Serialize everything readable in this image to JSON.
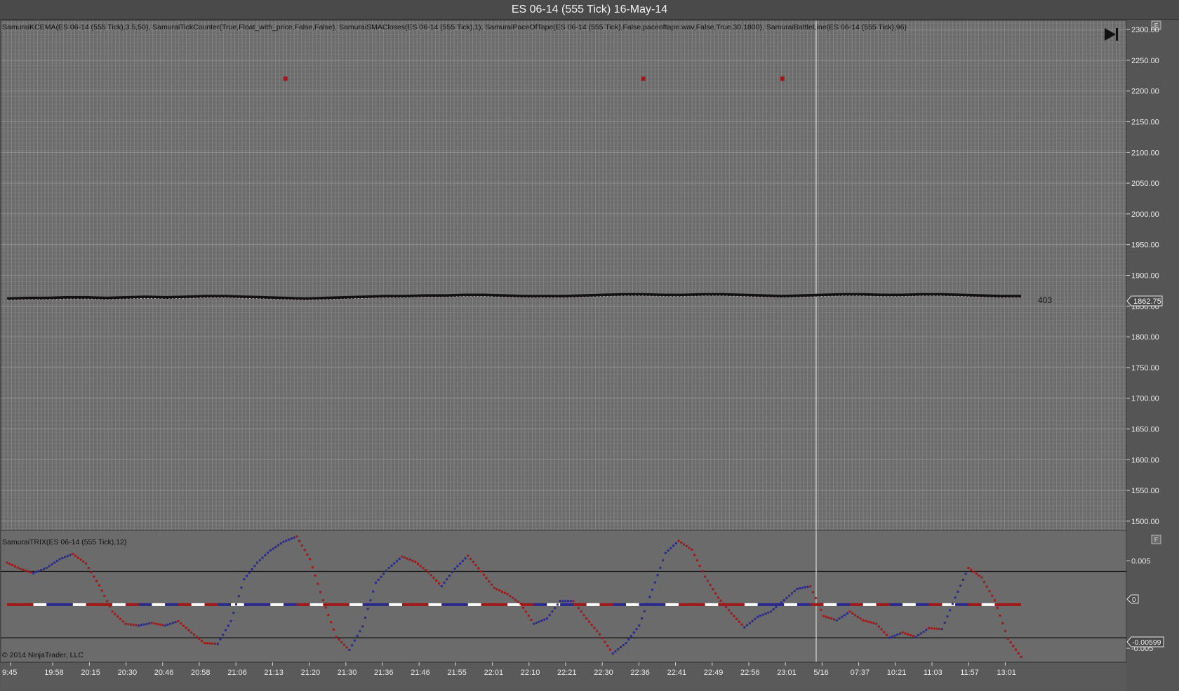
{
  "window": {
    "title": "ES 06-14 (555 Tick)  16-May-14"
  },
  "price_panel": {
    "indicators_label": "SamuraiKCEMA(ES 06-14 (555 Tick),3.5,50), SamuraiTickCounter(True,Float_with_price,False,False), SamuraiSMACloses(ES 06-14 (555 Tick),1), SamuraiPaceOfTape(ES 06-14 (555 Tick),False,paceoftape.wav,False,True,30,1800), SamuraiBattleLine(ES 06-14 (555 Tick),96)",
    "last_price_label": "1862.75",
    "tick_counter": "403",
    "panel_button": "F"
  },
  "trix_panel": {
    "label": "SamuraiTRIX(ES 06-14 (555 Tick),12)",
    "value_label": "-0.00599",
    "zero_label": "0",
    "panel_button": "F"
  },
  "copyright": "© 2014 NinjaTrader, LLC",
  "colors": {
    "background": "#6b6b6b",
    "gridline": "#8a8a8a",
    "price_line": "#111111",
    "price_highlight": "#e8c8c0",
    "trix_up": "#2a2a8c",
    "trix_down": "#a01818",
    "pace_marker": "#a01818",
    "zero_line": "#ffffff"
  },
  "chart_data": [
    {
      "type": "line",
      "title": "",
      "x_tick_labels": [
        "9:45",
        "19:58",
        "20:15",
        "20:30",
        "20:46",
        "20:58",
        "21:06",
        "21:13",
        "21:20",
        "21:30",
        "21:36",
        "21:46",
        "21:55",
        "22:01",
        "22:10",
        "22:21",
        "22:30",
        "22:36",
        "22:41",
        "22:49",
        "22:56",
        "23:01",
        "5/16",
        "07:37",
        "10:21",
        "11:03",
        "11:57",
        "13:01"
      ],
      "y_tick_labels": [
        "2300.00",
        "2250.00",
        "2200.00",
        "2150.00",
        "2100.00",
        "2050.00",
        "2000.00",
        "1950.00",
        "1900.00",
        "1850.00",
        "1800.00",
        "1750.00",
        "1700.00",
        "1650.00",
        "1600.00",
        "1550.00",
        "1500.00"
      ],
      "ylim": [
        1485,
        2315
      ],
      "series": [
        {
          "values": [
            1862,
            1863,
            1863,
            1864,
            1864,
            1863,
            1864,
            1865,
            1864,
            1865,
            1866,
            1866,
            1865,
            1864,
            1863,
            1862,
            1863,
            1864,
            1865,
            1866,
            1866,
            1867,
            1867,
            1868,
            1868,
            1867,
            1866,
            1866,
            1866,
            1867,
            1868,
            1869,
            1869,
            1868,
            1868,
            1869,
            1869,
            1868,
            1867,
            1866,
            1867,
            1868,
            1869,
            1869,
            1868,
            1868,
            1869,
            1869,
            1868,
            1867,
            1866,
            1866
          ]
        }
      ],
      "markers": [
        {
          "name": "pace of tape",
          "x_index": [
            14,
            32,
            39
          ],
          "y": 2220
        }
      ],
      "last_value": 1862.75,
      "grid": true
    },
    {
      "type": "line",
      "title": "",
      "y_tick_labels": [
        "0.005",
        "-0.005"
      ],
      "ylim": [
        -0.0066,
        0.0085
      ],
      "series": [
        {
          "values": [
            0.0048,
            0.0041,
            0.0036,
            0.0042,
            0.0052,
            0.0058,
            0.0047,
            0.0022,
            -0.0008,
            -0.0022,
            -0.0024,
            -0.0021,
            -0.0024,
            -0.0019,
            -0.0032,
            -0.0044,
            -0.0045,
            -0.0019,
            0.0029,
            0.0048,
            0.0062,
            0.0072,
            0.0078,
            0.0052,
            0.0005,
            -0.0037,
            -0.0052,
            -0.0025,
            0.0025,
            0.0042,
            0.0055,
            0.0049,
            0.0037,
            0.0021,
            0.0041,
            0.0056,
            0.0038,
            0.0019,
            0.0012,
            0.0001,
            -0.0022,
            -0.0016,
            0.0004,
            0.0004,
            -0.0016,
            -0.0034,
            -0.0056,
            -0.0044,
            -0.0024,
            0.0017,
            0.0059,
            0.0073,
            0.0063,
            0.0032,
            0.0008,
            -0.001,
            -0.0026,
            -0.0014,
            -0.0008,
            0.0005,
            0.0018,
            0.0021,
            -0.0013,
            -0.0018,
            -0.0008,
            -0.0018,
            -0.0022,
            -0.0038,
            -0.0032,
            -0.0037,
            -0.0027,
            -0.0028,
            0.0008,
            0.0042,
            0.0031,
            0.0005,
            -0.0039,
            -0.006
          ]
        }
      ],
      "upper_band": 0.0038,
      "lower_band": -0.0038,
      "last_value": -0.00599
    }
  ]
}
